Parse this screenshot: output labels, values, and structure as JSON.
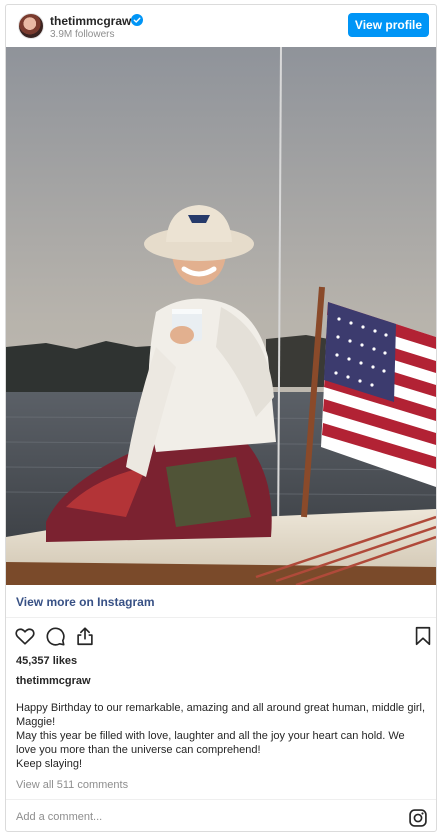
{
  "header": {
    "username": "thetimmcgraw",
    "followers": "3.9M followers",
    "view_profile_label": "View profile",
    "verified_icon": "verified-badge-icon"
  },
  "post": {
    "image_alt": "Woman in a white bucket hat and knit sweater sitting on a sailboat deck holding a mug, American flag on the stern",
    "view_more_label": "View more on Instagram",
    "likes": "45,357 likes",
    "caption_username": "thetimmcgraw",
    "caption_lines": [
      "Happy Birthday to our remarkable, amazing and all around great human, middle girl, Maggie!",
      "May this year be filled with love, laughter and all the joy your heart can hold. We love you more than the universe can comprehend!",
      "Keep slaying!"
    ],
    "view_comments": "View all 511 comments"
  },
  "actions": {
    "like_icon": "heart-icon",
    "comment_icon": "comment-icon",
    "share_icon": "share-icon",
    "save_icon": "bookmark-icon"
  },
  "comment": {
    "placeholder": "Add a comment..."
  },
  "colors": {
    "accent": "#0095f6",
    "link": "#385185",
    "muted": "#8e8e8e",
    "text": "#262626"
  }
}
